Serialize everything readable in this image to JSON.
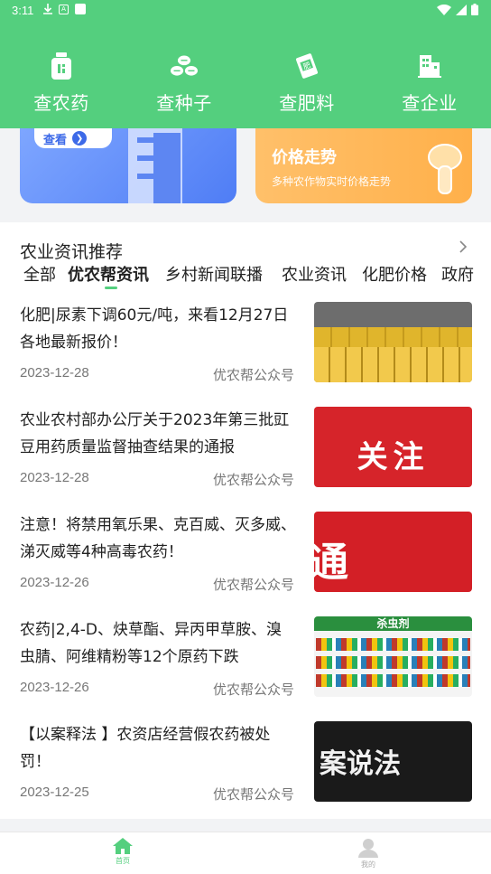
{
  "status": {
    "time": "3:11"
  },
  "nav": {
    "items": [
      {
        "label": "查农药",
        "icon": "pesticide-bottle-icon"
      },
      {
        "label": "查种子",
        "icon": "seeds-icon"
      },
      {
        "label": "查肥料",
        "icon": "fertilizer-bag-icon"
      },
      {
        "label": "查企业",
        "icon": "building-icon"
      }
    ]
  },
  "banners": {
    "left": {
      "button_label": "查看"
    },
    "right": {
      "title": "价格走势",
      "subtitle": "多种农作物实时价格走势"
    }
  },
  "news": {
    "section_title": "农业资讯推荐",
    "tabs": [
      "全部",
      "优农帮资讯",
      "乡村新闻联播",
      "农业资讯",
      "化肥价格",
      "政府"
    ],
    "active_tab": 1,
    "items": [
      {
        "title": "化肥|尿素下调60元/吨，来看12月27日各地最新报价！",
        "date": "2023-12-28",
        "source": "优农帮公众号",
        "thumb": "fertilizer"
      },
      {
        "title": "农业农村部办公厅关于2023年第三批豇豆用药质量监督抽查结果的通报",
        "date": "2023-12-28",
        "source": "优农帮公众号",
        "thumb": "关注"
      },
      {
        "title": "注意！将禁用氧乐果、克百威、灭多威、涕灭威等4种高毒农药！",
        "date": "2023-12-26",
        "source": "优农帮公众号",
        "thumb": "通告"
      },
      {
        "title": "农药|2,4-D、炔草酯、异丙甲草胺、溴虫腈、阿维精粉等12个原药下跌",
        "date": "2023-12-26",
        "source": "优农帮公众号",
        "thumb": "杀虫剂"
      },
      {
        "title": "【以案释法 】农资店经营假农药被处罚！",
        "date": "2023-12-25",
        "source": "优农帮公众号",
        "thumb": "案说法"
      }
    ]
  },
  "bottom_nav": {
    "home_label": "首页",
    "mine_label": "我的"
  },
  "colors": {
    "brand_green": "#54cf7e",
    "banner_blue": "#4f7df5",
    "banner_orange": "#ffb04a"
  }
}
